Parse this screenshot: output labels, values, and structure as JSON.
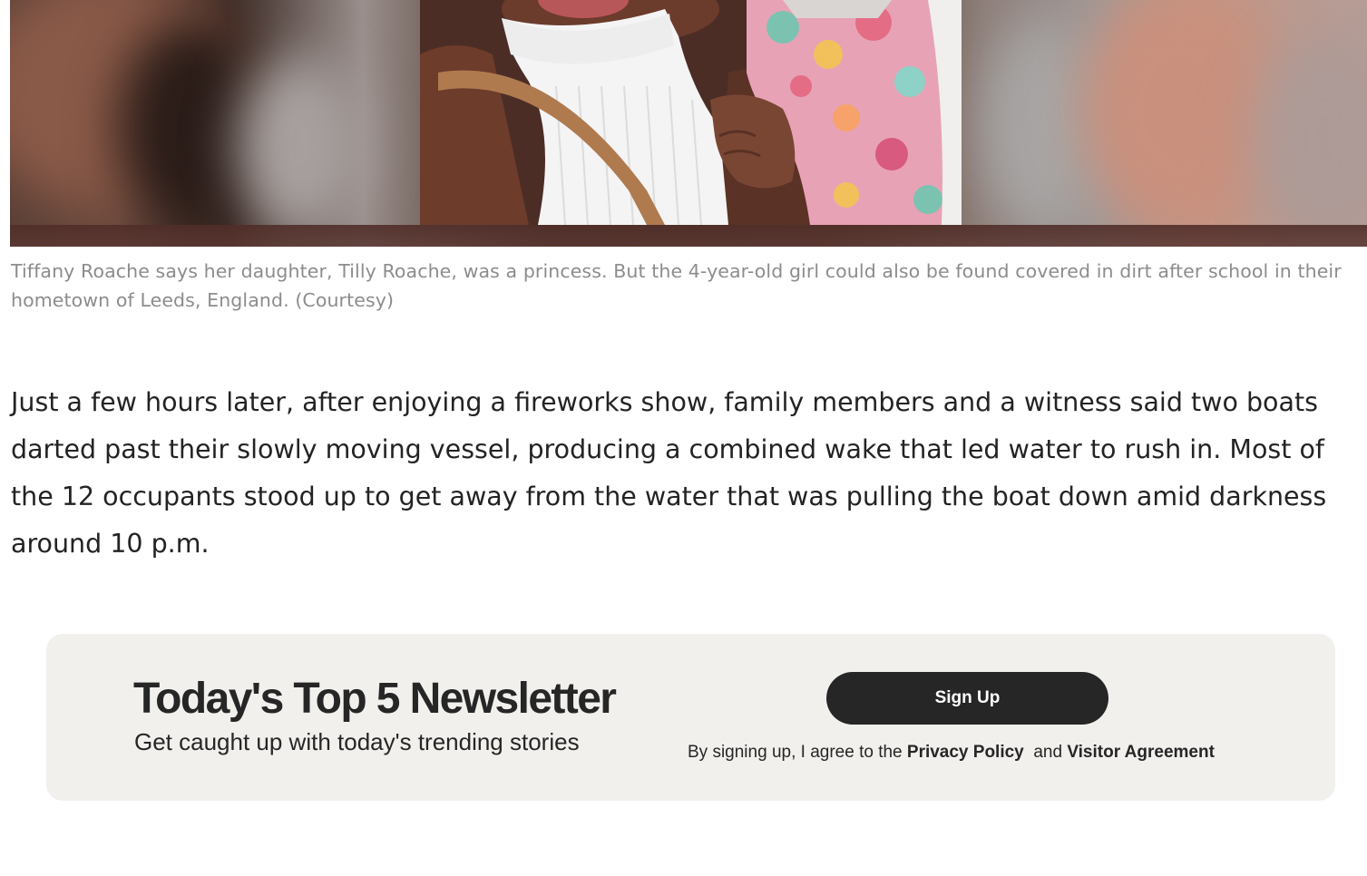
{
  "caption": "Tiffany Roache says her daughter, Tilly Roache, was a princess. But the 4-year-old girl could also be found covered in dirt after school in their hometown of Leeds, England. (Courtesy)",
  "article_paragraph": "Just a few hours later, after enjoying a fireworks show, family members and a witness said two boats darted past their slowly moving vessel, producing a combined wake that led water to rush in. Most of the 12 occupants stood up to get away from the water that was pulling the boat down amid darkness around 10 p.m.",
  "newsletter": {
    "title": "Today's Top 5 Newsletter",
    "subtitle": "Get caught up with today's trending stories",
    "signup_label": "Sign Up",
    "legal_prefix": "By signing up, I agree to the",
    "privacy_policy_label": "Privacy Policy",
    "legal_and": "and",
    "visitor_agreement_label": "Visitor Agreement"
  },
  "colors": {
    "body_text": "#232323",
    "caption_text": "#8c8c8c",
    "newsletter_bg": "#f1f0ed",
    "button_bg": "#262626",
    "button_text": "#ffffff"
  }
}
